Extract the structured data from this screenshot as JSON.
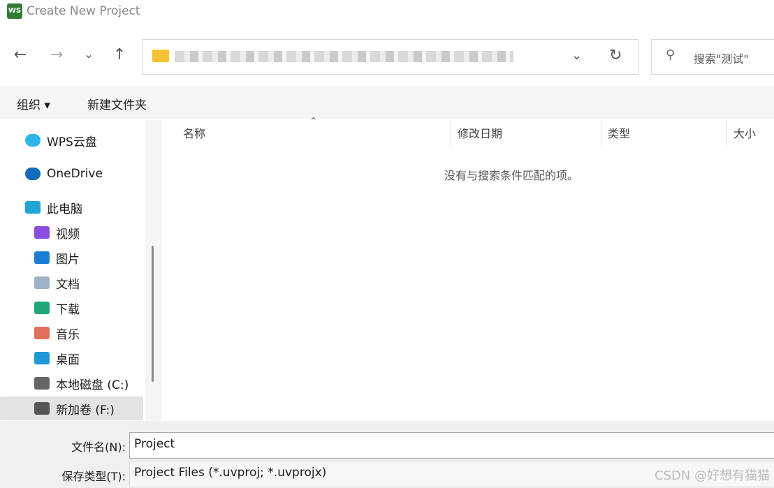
{
  "window": {
    "title": "Create New Project",
    "logo_text": "WS"
  },
  "nav": {
    "back": "←",
    "forward": "→",
    "recent": "⌄",
    "up": "↑",
    "dropdown": "⌄",
    "refresh": "↻"
  },
  "search": {
    "placeholder": "搜索\"测试\""
  },
  "toolbar": {
    "organize": "组织 ▾",
    "new_folder": "新建文件夹"
  },
  "sidebar": {
    "items": [
      {
        "label": "WPS云盘",
        "icon": "wps-cloud-icon",
        "color": "#2bb5e8"
      },
      {
        "label": "OneDrive",
        "icon": "onedrive-icon",
        "color": "#0f6cbd"
      },
      {
        "label": "此电脑",
        "icon": "computer-icon",
        "color": "#1fa4d8"
      },
      {
        "label": "视频",
        "icon": "video-icon",
        "color": "#8a4de0"
      },
      {
        "label": "图片",
        "icon": "pictures-icon",
        "color": "#1a7fd4"
      },
      {
        "label": "文档",
        "icon": "documents-icon",
        "color": "#9fb2c8"
      },
      {
        "label": "下载",
        "icon": "download-icon",
        "color": "#1fa77a"
      },
      {
        "label": "音乐",
        "icon": "music-icon",
        "color": "#e0705a"
      },
      {
        "label": "桌面",
        "icon": "desktop-icon",
        "color": "#1d9ad6"
      },
      {
        "label": "本地磁盘 (C:)",
        "icon": "drive-c-icon",
        "color": "#666666"
      },
      {
        "label": "新加卷 (F:)",
        "icon": "drive-icon",
        "color": "#555555",
        "selected": true
      }
    ]
  },
  "columns": [
    "名称",
    "修改日期",
    "类型",
    "大小"
  ],
  "empty_message": "没有与搜索条件匹配的项。",
  "form": {
    "filename_label": "文件名(N):",
    "filename_value": "Project",
    "type_label": "保存类型(T):",
    "type_value": "Project Files (*.uvproj; *.uvprojx)"
  },
  "watermark": "CSDN @好想有猫猫"
}
